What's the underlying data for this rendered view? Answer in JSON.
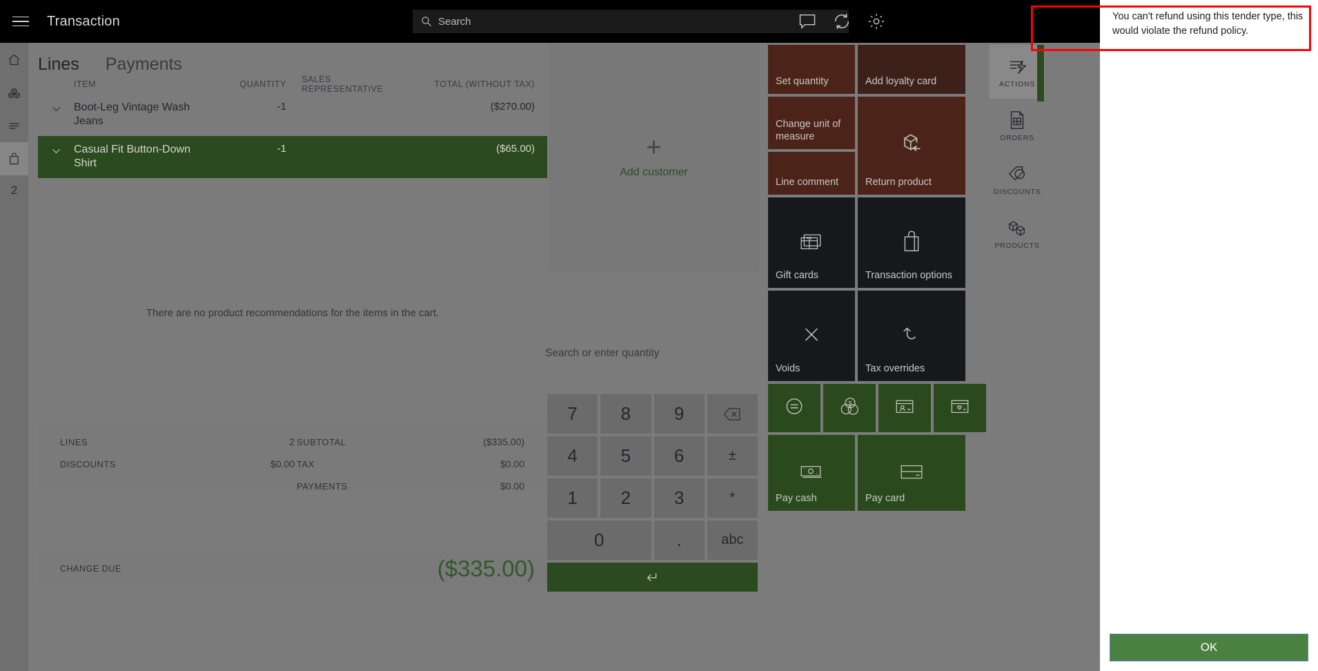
{
  "header": {
    "title": "Transaction",
    "menu_icon": "hamburger-icon",
    "search_placeholder": "Search",
    "icons": [
      "feedback-icon",
      "sync-icon",
      "settings-icon"
    ]
  },
  "left_rail": {
    "items": [
      {
        "icon": "home-icon",
        "selected": false
      },
      {
        "icon": "inventory-icon",
        "selected": false
      },
      {
        "icon": "list-icon",
        "selected": false
      },
      {
        "icon": "cart-icon",
        "selected": true
      }
    ],
    "count": "2"
  },
  "tabs": [
    {
      "label": "Lines",
      "active": true
    },
    {
      "label": "Payments",
      "active": false
    }
  ],
  "lines": {
    "columns": {
      "item": "ITEM",
      "quantity": "QUANTITY",
      "sales_rep": "SALES REPRESENTATIVE",
      "total": "TOTAL (WITHOUT TAX)"
    },
    "rows": [
      {
        "item": "Boot-Leg Vintage Wash Jeans",
        "quantity": "-1",
        "sales_rep": "",
        "total": "($270.00)",
        "selected": false
      },
      {
        "item": "Casual Fit Button-Down Shirt",
        "quantity": "-1",
        "sales_rep": "",
        "total": "($65.00)",
        "selected": true
      }
    ],
    "empty_recommendations": "There are no product recommendations for the items in the cart."
  },
  "totals": {
    "left": [
      {
        "label": "LINES",
        "value": "2"
      },
      {
        "label": "DISCOUNTS",
        "value": "$0.00"
      }
    ],
    "right": [
      {
        "label": "SUBTOTAL",
        "value": "($335.00)"
      },
      {
        "label": "TAX",
        "value": "$0.00"
      },
      {
        "label": "PAYMENTS",
        "value": "$0.00"
      }
    ],
    "change_due_label": "CHANGE DUE",
    "change_due_value": "($335.00)"
  },
  "customer": {
    "add_label": "Add customer",
    "plus_icon": "plus-icon"
  },
  "product_search": {
    "placeholder": "Search or enter quantity"
  },
  "keypad": {
    "keys": [
      "7",
      "8",
      "9",
      "4",
      "5",
      "6",
      "1",
      "2",
      "3",
      "0",
      "."
    ],
    "backspace_icon": "backspace-icon",
    "plusminus_label": "±",
    "asterisk_label": "*",
    "abc_label": "abc",
    "enter_icon": "enter-icon"
  },
  "tiles": [
    {
      "label": "Set quantity",
      "style": "brown",
      "icon": ""
    },
    {
      "label": "Add loyalty card",
      "style": "brown2",
      "icon": ""
    },
    {
      "label": "Change unit of measure",
      "style": "brown",
      "icon": ""
    },
    {
      "label": "Return product",
      "style": "brown",
      "icon": "return-product-icon"
    },
    {
      "label": "Line comment",
      "style": "brown",
      "icon": ""
    },
    {
      "label": "Gift cards",
      "style": "dark",
      "icon": "gift-card-icon"
    },
    {
      "label": "Transaction options",
      "style": "dark",
      "icon": "shopping-bag-icon"
    },
    {
      "label": "Voids",
      "style": "dark",
      "icon": "close-x-icon"
    },
    {
      "label": "Tax overrides",
      "style": "dark",
      "icon": "undo-arrow-icon"
    },
    {
      "label": "",
      "style": "green",
      "icon": "equals-circle-icon"
    },
    {
      "label": "",
      "style": "green",
      "icon": "currency-coins-icon"
    },
    {
      "label": "",
      "style": "green",
      "icon": "customer-card-icon"
    },
    {
      "label": "",
      "style": "green",
      "icon": "loyalty-card-icon"
    },
    {
      "label": "Pay cash",
      "style": "green",
      "icon": "cash-icon"
    },
    {
      "label": "Pay card",
      "style": "green",
      "icon": "credit-card-icon"
    }
  ],
  "right_nav": [
    {
      "label": "ACTIONS",
      "icon": "actions-icon",
      "selected": true
    },
    {
      "label": "ORDERS",
      "icon": "orders-icon",
      "selected": false
    },
    {
      "label": "DISCOUNTS",
      "icon": "discounts-icon",
      "selected": false
    },
    {
      "label": "PRODUCTS",
      "icon": "products-icon",
      "selected": false
    }
  ],
  "dialog": {
    "message": "You can't refund using this tender type, this would violate the refund policy.",
    "ok_label": "OK"
  }
}
